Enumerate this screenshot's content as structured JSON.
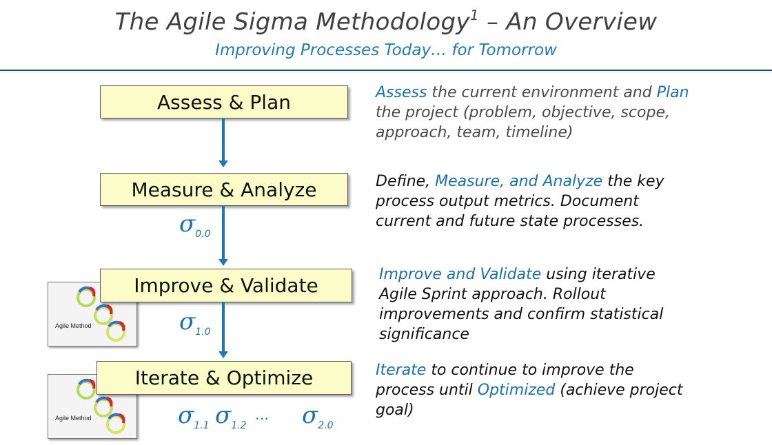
{
  "header": {
    "title": "The Agile Sigma Methodology",
    "title_superscript": "1",
    "title_suffix": " – An Overview",
    "subtitle": "Improving Processes Today… for Tomorrow"
  },
  "colors": {
    "accent_blue": "#1b6fb0",
    "box_fill": "#fcfcc8",
    "arrow": "#1b77b5",
    "title_gray": "#404040"
  },
  "steps": [
    {
      "label": "Assess & Plan",
      "description": [
        {
          "text": "Assess",
          "highlight": true
        },
        {
          "text": " the current environment and ",
          "highlight": false
        },
        {
          "text": "Plan",
          "highlight": true
        },
        {
          "text": " the project (problem, objective, scope, approach, team, timeline)",
          "highlight": false
        }
      ]
    },
    {
      "label": "Measure & Analyze",
      "sigma": {
        "symbol": "σ",
        "sub": "0.0"
      },
      "description": [
        {
          "text": "Define, ",
          "highlight": false
        },
        {
          "text": "Measure, and Analyze",
          "highlight": true
        },
        {
          "text": " the key process output metrics. Document current and future state processes.",
          "highlight": false
        }
      ]
    },
    {
      "label": "Improve & Validate",
      "sigma": {
        "symbol": "σ",
        "sub": "1.0"
      },
      "thumbnail_label": "Agile Method",
      "description": [
        {
          "text": "Improve and Validate",
          "highlight": true
        },
        {
          "text": " using iterative Agile Sprint approach. Rollout improvements and confirm statistical significance",
          "highlight": false
        }
      ]
    },
    {
      "label": "Iterate & Optimize",
      "sigmas": [
        {
          "symbol": "σ",
          "sub": "1.1"
        },
        {
          "symbol": "σ",
          "sub": "1.2"
        },
        {
          "symbol": "…",
          "sub": ""
        },
        {
          "symbol": "σ",
          "sub": "2.0"
        }
      ],
      "thumbnail_label": "Agile Method",
      "description": [
        {
          "text": "Iterate",
          "highlight": true
        },
        {
          "text": " to continue to improve the process until ",
          "highlight": false
        },
        {
          "text": "Optimized",
          "highlight": true
        },
        {
          "text": " (achieve project goal)",
          "highlight": false
        }
      ]
    }
  ]
}
